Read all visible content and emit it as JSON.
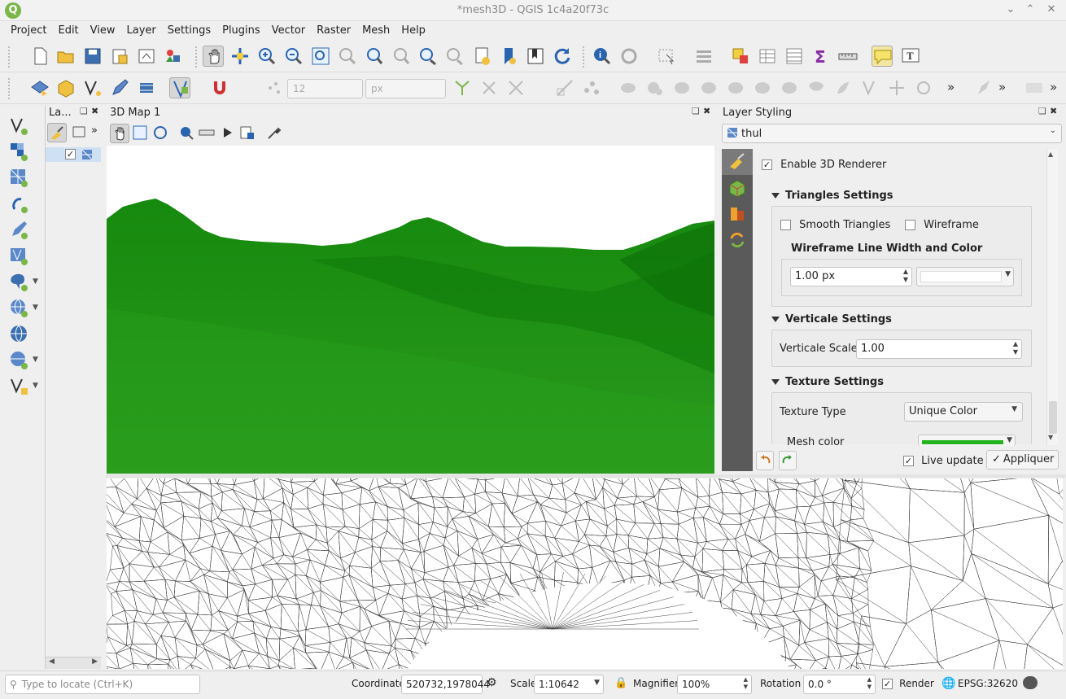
{
  "window": {
    "title": "*mesh3D - QGIS 1c4a20f73c"
  },
  "menu": [
    "Project",
    "Edit",
    "View",
    "Layer",
    "Settings",
    "Plugins",
    "Vector",
    "Raster",
    "Mesh",
    "Help"
  ],
  "toolbar2": {
    "font_size": "12",
    "unit": "px"
  },
  "layers_panel": {
    "title": "La..."
  },
  "map3d": {
    "title": "3D Map 1",
    "terrain_color": "#1a8a10"
  },
  "styling": {
    "title": "Layer Styling",
    "layer": "thul",
    "enable_3d": "Enable 3D Renderer",
    "triangles_header": "Triangles Settings",
    "smooth": "Smooth Triangles",
    "wireframe": "Wireframe",
    "wire_label": "Wireframe Line Width and Color",
    "wire_width": "1.00 px",
    "verticale_header": "Verticale Settings",
    "verticale_label": "Verticale Scale",
    "verticale_value": "1.00",
    "texture_header": "Texture Settings",
    "texture_label": "Texture Type",
    "texture_value": "Unique Color",
    "mesh_color_label": "Mesh color",
    "mesh_color": "#22b41e",
    "live_update": "Live update",
    "apply": "Appliquer"
  },
  "status": {
    "locate_placeholder": "Type to locate (Ctrl+K)",
    "coord_label": "Coordinate",
    "coord_value": "520732,1978044",
    "scale_label": "Scale",
    "scale_value": "1:10642",
    "magnifier_label": "Magnifier",
    "magnifier_value": "100%",
    "rotation_label": "Rotation",
    "rotation_value": "0.0 °",
    "render_label": "Render",
    "crs": "EPSG:32620"
  }
}
